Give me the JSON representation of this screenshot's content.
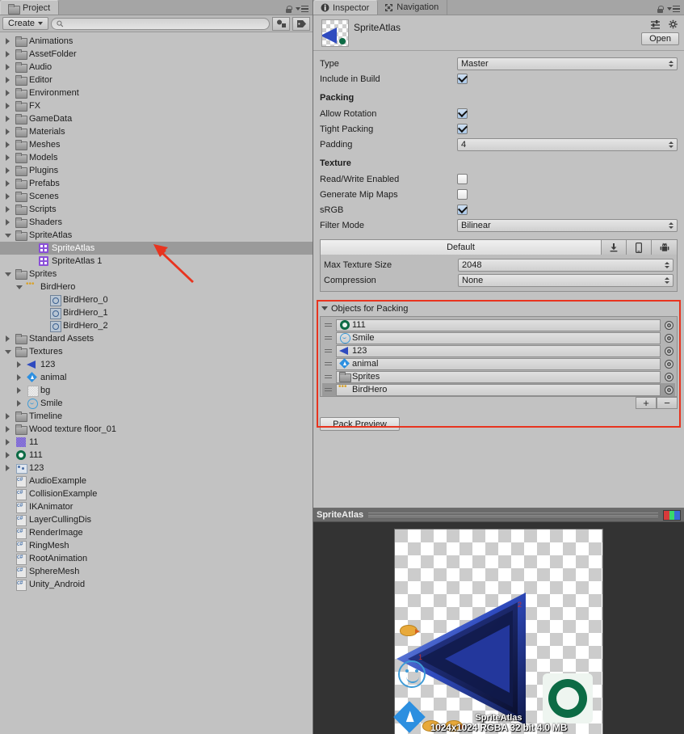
{
  "project": {
    "tab_label": "Project",
    "tab_icon": "folder-icon",
    "create_label": "Create",
    "search_placeholder": "",
    "search_value": "",
    "filter_type_icon": "object-type-filter-icon",
    "filter_label_icon": "label-filter-icon",
    "lock_icon": "lock-icon",
    "menu_icon": "panel-menu-icon",
    "tree": [
      {
        "label": "Animations",
        "indent": 0,
        "arrow": "closed",
        "icon": "folder"
      },
      {
        "label": "AssetFolder",
        "indent": 0,
        "arrow": "closed",
        "icon": "folder"
      },
      {
        "label": "Audio",
        "indent": 0,
        "arrow": "closed",
        "icon": "folder"
      },
      {
        "label": "Editor",
        "indent": 0,
        "arrow": "closed",
        "icon": "folder"
      },
      {
        "label": "Environment",
        "indent": 0,
        "arrow": "closed",
        "icon": "folder"
      },
      {
        "label": "FX",
        "indent": 0,
        "arrow": "closed",
        "icon": "folder"
      },
      {
        "label": "GameData",
        "indent": 0,
        "arrow": "closed",
        "icon": "folder"
      },
      {
        "label": "Materials",
        "indent": 0,
        "arrow": "closed",
        "icon": "folder"
      },
      {
        "label": "Meshes",
        "indent": 0,
        "arrow": "closed",
        "icon": "folder"
      },
      {
        "label": "Models",
        "indent": 0,
        "arrow": "closed",
        "icon": "folder"
      },
      {
        "label": "Plugins",
        "indent": 0,
        "arrow": "closed",
        "icon": "folder"
      },
      {
        "label": "Prefabs",
        "indent": 0,
        "arrow": "closed",
        "icon": "folder"
      },
      {
        "label": "Scenes",
        "indent": 0,
        "arrow": "closed",
        "icon": "folder"
      },
      {
        "label": "Scripts",
        "indent": 0,
        "arrow": "closed",
        "icon": "folder"
      },
      {
        "label": "Shaders",
        "indent": 0,
        "arrow": "closed",
        "icon": "folder"
      },
      {
        "label": "SpriteAtlas",
        "indent": 0,
        "arrow": "open",
        "icon": "folder"
      },
      {
        "label": "SpriteAtlas",
        "indent": 2,
        "arrow": "none",
        "icon": "atlas",
        "selected": true
      },
      {
        "label": "SpriteAtlas 1",
        "indent": 2,
        "arrow": "none",
        "icon": "atlas"
      },
      {
        "label": "Sprites",
        "indent": 0,
        "arrow": "open",
        "icon": "folder"
      },
      {
        "label": "BirdHero",
        "indent": 1,
        "arrow": "open",
        "icon": "birds"
      },
      {
        "label": "BirdHero_0",
        "indent": 3,
        "arrow": "none",
        "icon": "sprite"
      },
      {
        "label": "BirdHero_1",
        "indent": 3,
        "arrow": "none",
        "icon": "sprite"
      },
      {
        "label": "BirdHero_2",
        "indent": 3,
        "arrow": "none",
        "icon": "sprite"
      },
      {
        "label": "Standard Assets",
        "indent": 0,
        "arrow": "closed",
        "icon": "folder"
      },
      {
        "label": "Textures",
        "indent": 0,
        "arrow": "open",
        "icon": "folder"
      },
      {
        "label": "123",
        "indent": 1,
        "arrow": "closed",
        "icon": "tri123"
      },
      {
        "label": "animal",
        "indent": 1,
        "arrow": "closed",
        "icon": "diamond"
      },
      {
        "label": "bg",
        "indent": 1,
        "arrow": "closed",
        "icon": "bg"
      },
      {
        "label": "Smile",
        "indent": 1,
        "arrow": "closed",
        "icon": "smile"
      },
      {
        "label": "Timeline",
        "indent": 0,
        "arrow": "closed",
        "icon": "folder"
      },
      {
        "label": "Wood texture floor_01",
        "indent": 0,
        "arrow": "closed",
        "icon": "folder"
      },
      {
        "label": "11",
        "indent": 0,
        "arrow": "closed",
        "icon": "noise11"
      },
      {
        "label": "111",
        "indent": 0,
        "arrow": "closed",
        "icon": "starbucks"
      },
      {
        "label": "123",
        "indent": 0,
        "arrow": "closed",
        "icon": "tex123"
      },
      {
        "label": "AudioExample",
        "indent": 0,
        "arrow": "none",
        "icon": "script"
      },
      {
        "label": "CollisionExample",
        "indent": 0,
        "arrow": "none",
        "icon": "script"
      },
      {
        "label": "IKAnimator",
        "indent": 0,
        "arrow": "none",
        "icon": "script"
      },
      {
        "label": "LayerCullingDis",
        "indent": 0,
        "arrow": "none",
        "icon": "script"
      },
      {
        "label": "RenderImage",
        "indent": 0,
        "arrow": "none",
        "icon": "script"
      },
      {
        "label": "RingMesh",
        "indent": 0,
        "arrow": "none",
        "icon": "script"
      },
      {
        "label": "RootAnimation",
        "indent": 0,
        "arrow": "none",
        "icon": "script"
      },
      {
        "label": "SphereMesh",
        "indent": 0,
        "arrow": "none",
        "icon": "script"
      },
      {
        "label": "Unity_Android",
        "indent": 0,
        "arrow": "none",
        "icon": "script"
      }
    ]
  },
  "inspector": {
    "tabs": [
      {
        "label": "Inspector",
        "icon": "info-icon",
        "active": true
      },
      {
        "label": "Navigation",
        "icon": "navigation-icon",
        "active": false
      }
    ],
    "lock_icon": "lock-icon",
    "menu_icon": "panel-menu-icon",
    "title": "SpriteAtlas",
    "preset_icon": "preset-icon",
    "gear_icon": "gear-icon",
    "open_label": "Open",
    "type": {
      "label": "Type",
      "value": "Master"
    },
    "include_in_build": {
      "label": "Include in Build",
      "checked": true
    },
    "packing": {
      "header": "Packing",
      "allow_rotation": {
        "label": "Allow Rotation",
        "checked": true
      },
      "tight_packing": {
        "label": "Tight Packing",
        "checked": true
      },
      "padding": {
        "label": "Padding",
        "value": "4"
      }
    },
    "texture": {
      "header": "Texture",
      "read_write": {
        "label": "Read/Write Enabled",
        "checked": false
      },
      "mip_maps": {
        "label": "Generate Mip Maps",
        "checked": false
      },
      "srgb": {
        "label": "sRGB",
        "checked": true
      },
      "filter_mode": {
        "label": "Filter Mode",
        "value": "Bilinear"
      }
    },
    "platform": {
      "tabs": [
        {
          "label": "Default",
          "icon": "default-tab"
        },
        {
          "label": "",
          "icon": "standalone-icon"
        },
        {
          "label": "",
          "icon": "ios-icon"
        },
        {
          "label": "",
          "icon": "android-icon"
        }
      ],
      "max_texture_size": {
        "label": "Max Texture Size",
        "value": "2048"
      },
      "compression": {
        "label": "Compression",
        "value": "None"
      }
    },
    "objects_for_packing": {
      "header": "Objects for Packing",
      "items": [
        {
          "name": "111",
          "icon": "starbucks"
        },
        {
          "name": "Smile",
          "icon": "smile"
        },
        {
          "name": "123",
          "icon": "tri123"
        },
        {
          "name": "animal",
          "icon": "diamond"
        },
        {
          "name": "Sprites",
          "icon": "folder"
        },
        {
          "name": "BirdHero",
          "icon": "birds",
          "selected": true
        }
      ],
      "add_label": "+",
      "remove_label": "−"
    },
    "pack_preview_label": "Pack Preview"
  },
  "preview": {
    "title": "SpriteAtlas",
    "rgb_icon": "rgb-channel-icon",
    "atlas_name": "SpriteAtlas",
    "atlas_info": "1024x1024 RGBA 32 bit  4.0 MB",
    "sprite_label_1": "1",
    "sprite_label_2": "2"
  },
  "annotation": {
    "arrow_color": "#e8341f",
    "box_color": "#e8341f"
  }
}
